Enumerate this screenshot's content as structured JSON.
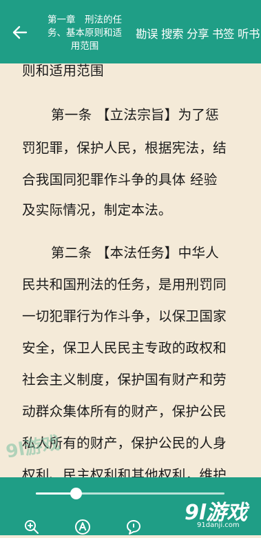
{
  "header": {
    "title_lines": [
      "第一章　刑法的任",
      "务、基本原则和适",
      "用范围"
    ],
    "actions": [
      "勘误",
      "搜索",
      "分享",
      "书签",
      "听书"
    ]
  },
  "content": {
    "lines": [
      "则和适用范围",
      "第一条 【立法宗旨】为了惩",
      "罚犯罪，保护人民，根据宪法，结",
      "合我国同犯罪作斗争的具体 经验",
      "及实际情况，制定本法。",
      "第二条 【本法任务】中华人",
      "民共和国刑法的任务，是用刑罚同",
      "一切犯罪行为作斗争，以保卫国家",
      "安全，保卫人民民主专政的政权和",
      "社会主义制度，保护国有财产和劳",
      "动群众集体所有的财产，保护公民",
      "私人所有的财产，保护公民的人身",
      "权利、民主权利和其他权利，维护"
    ]
  },
  "progress": {
    "value": 0.21
  },
  "watermark": {
    "left_text": "9l游戏",
    "brand": "9l游戏",
    "url": "91danji.com"
  },
  "colors": {
    "accent": "#1f9e86",
    "page": "#f4ead8",
    "text": "#1a1a1a"
  },
  "toolbar_icons": [
    "zoom-in-icon",
    "font-icon",
    "comment-icon"
  ]
}
